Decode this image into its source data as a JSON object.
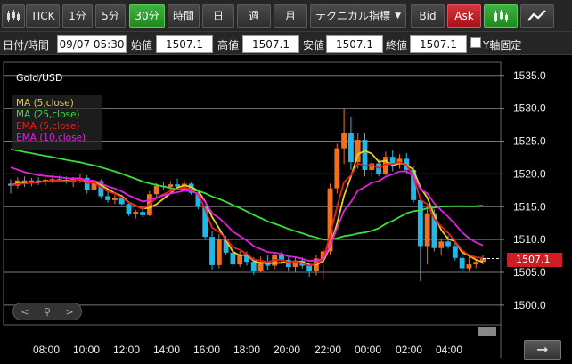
{
  "toolbar": {
    "tick_label": "TICK",
    "intervals": [
      "1分",
      "5分",
      "30分",
      "時間",
      "日",
      "週",
      "月"
    ],
    "active_interval": "30分",
    "technical_label": "テクニカル指標",
    "bid_label": "Bid",
    "ask_label": "Ask"
  },
  "ohlc": {
    "datetime_label": "日付/時間",
    "datetime_value": "09/07 05:30",
    "open_label": "始値",
    "open_value": "1507.1",
    "high_label": "高値",
    "high_value": "1507.1",
    "low_label": "安値",
    "low_value": "1507.1",
    "close_label": "終値",
    "close_value": "1507.1",
    "fix_y_label": "Y軸固定"
  },
  "chart_data": {
    "type": "candlestick",
    "symbol": "Gold/USD",
    "current_price": "1507.1",
    "ylim": [
      1497,
      1537
    ],
    "y_ticks": [
      "1535.0",
      "1530.0",
      "1525.0",
      "1520.0",
      "1515.0",
      "1510.0",
      "1505.0",
      "1500.0"
    ],
    "x_ticks": [
      "08:00",
      "10:00",
      "12:00",
      "14:00",
      "16:00",
      "18:00",
      "20:00",
      "22:00",
      "00:00",
      "02:00",
      "04:00"
    ],
    "legend": [
      {
        "name": "MA (5,close)",
        "color": "#e8d020"
      },
      {
        "name": "MA (25,close)",
        "color": "#3cdc3c"
      },
      {
        "name": "EMA (5,close)",
        "color": "#e82020"
      },
      {
        "name": "EMA (10,close)",
        "color": "#e020e0"
      }
    ],
    "colors": {
      "up": "#f07020",
      "down": "#20b8e8"
    },
    "candles": [
      [
        1518.5,
        1519.2,
        1517.0,
        1518.2
      ],
      [
        1518.2,
        1519.5,
        1517.8,
        1519.0
      ],
      [
        1519.0,
        1519.6,
        1518.0,
        1518.6
      ],
      [
        1518.6,
        1519.4,
        1518.1,
        1519.0
      ],
      [
        1519.0,
        1519.5,
        1518.3,
        1518.8
      ],
      [
        1518.8,
        1519.3,
        1518.2,
        1519.1
      ],
      [
        1519.1,
        1519.8,
        1518.6,
        1519.2
      ],
      [
        1519.2,
        1519.7,
        1518.9,
        1519.0
      ],
      [
        1519.0,
        1519.6,
        1518.5,
        1518.7
      ],
      [
        1518.7,
        1519.5,
        1518.0,
        1519.2
      ],
      [
        1519.2,
        1519.9,
        1518.6,
        1519.4
      ],
      [
        1519.4,
        1519.8,
        1517.0,
        1517.5
      ],
      [
        1517.5,
        1519.2,
        1516.6,
        1518.9
      ],
      [
        1518.9,
        1519.2,
        1516.2,
        1516.6
      ],
      [
        1516.6,
        1517.3,
        1515.6,
        1516.0
      ],
      [
        1516.0,
        1516.8,
        1515.4,
        1516.3
      ],
      [
        1516.3,
        1516.6,
        1515.2,
        1515.4
      ],
      [
        1515.4,
        1515.8,
        1513.6,
        1513.9
      ],
      [
        1513.9,
        1514.5,
        1513.2,
        1514.2
      ],
      [
        1514.2,
        1514.8,
        1513.4,
        1513.7
      ],
      [
        1513.7,
        1517.4,
        1513.5,
        1516.9
      ],
      [
        1516.9,
        1518.6,
        1516.4,
        1518.2
      ],
      [
        1518.2,
        1518.8,
        1517.5,
        1518.0
      ],
      [
        1518.0,
        1518.9,
        1517.3,
        1518.4
      ],
      [
        1518.4,
        1519.3,
        1517.8,
        1518.1
      ],
      [
        1518.1,
        1519.0,
        1517.6,
        1518.5
      ],
      [
        1518.5,
        1518.8,
        1516.8,
        1517.1
      ],
      [
        1517.1,
        1517.5,
        1514.6,
        1515.0
      ],
      [
        1515.0,
        1515.2,
        1510.0,
        1510.4
      ],
      [
        1510.4,
        1511.4,
        1505.4,
        1506.1
      ],
      [
        1506.1,
        1510.8,
        1505.6,
        1510.0
      ],
      [
        1510.0,
        1510.6,
        1507.6,
        1508.0
      ],
      [
        1508.0,
        1508.6,
        1505.5,
        1506.2
      ],
      [
        1506.2,
        1508.2,
        1505.8,
        1507.6
      ],
      [
        1507.6,
        1508.2,
        1506.0,
        1506.6
      ],
      [
        1506.6,
        1507.3,
        1504.6,
        1505.2
      ],
      [
        1505.2,
        1507.4,
        1505.0,
        1506.6
      ],
      [
        1506.6,
        1507.6,
        1505.4,
        1506.0
      ],
      [
        1506.0,
        1508.0,
        1505.5,
        1507.6
      ],
      [
        1507.6,
        1508.2,
        1506.2,
        1506.9
      ],
      [
        1506.9,
        1507.3,
        1505.2,
        1505.8
      ],
      [
        1505.8,
        1507.3,
        1505.0,
        1506.8
      ],
      [
        1506.8,
        1507.3,
        1505.6,
        1506.0
      ],
      [
        1506.0,
        1506.5,
        1504.3,
        1505.2
      ],
      [
        1505.2,
        1507.6,
        1504.5,
        1507.1
      ],
      [
        1507.1,
        1508.6,
        1503.9,
        1508.2
      ],
      [
        1508.2,
        1518.5,
        1507.6,
        1517.8
      ],
      [
        1517.8,
        1524.6,
        1517.0,
        1523.9
      ],
      [
        1523.9,
        1530.0,
        1521.5,
        1526.2
      ],
      [
        1526.2,
        1528.6,
        1520.6,
        1521.8
      ],
      [
        1521.8,
        1526.2,
        1520.8,
        1525.2
      ],
      [
        1525.2,
        1526.2,
        1519.6,
        1520.6
      ],
      [
        1520.6,
        1522.4,
        1519.4,
        1521.6
      ],
      [
        1521.6,
        1522.2,
        1519.6,
        1520.0
      ],
      [
        1520.0,
        1523.4,
        1519.8,
        1522.6
      ],
      [
        1522.6,
        1523.6,
        1520.4,
        1521.6
      ],
      [
        1521.6,
        1523.0,
        1520.8,
        1522.3
      ],
      [
        1522.3,
        1523.2,
        1520.0,
        1520.6
      ],
      [
        1520.6,
        1521.2,
        1515.6,
        1516.0
      ],
      [
        1516.0,
        1516.4,
        1503.6,
        1509.0
      ],
      [
        1509.0,
        1514.8,
        1506.2,
        1514.0
      ],
      [
        1514.0,
        1514.6,
        1508.2,
        1508.7
      ],
      [
        1508.7,
        1510.2,
        1507.6,
        1509.7
      ],
      [
        1509.7,
        1510.6,
        1508.6,
        1509.0
      ],
      [
        1509.0,
        1509.6,
        1506.8,
        1507.2
      ],
      [
        1507.2,
        1508.6,
        1505.0,
        1505.6
      ],
      [
        1505.6,
        1507.6,
        1505.2,
        1506.2
      ],
      [
        1506.2,
        1507.0,
        1505.6,
        1506.6
      ],
      [
        1506.6,
        1507.6,
        1506.2,
        1507.1
      ]
    ]
  }
}
